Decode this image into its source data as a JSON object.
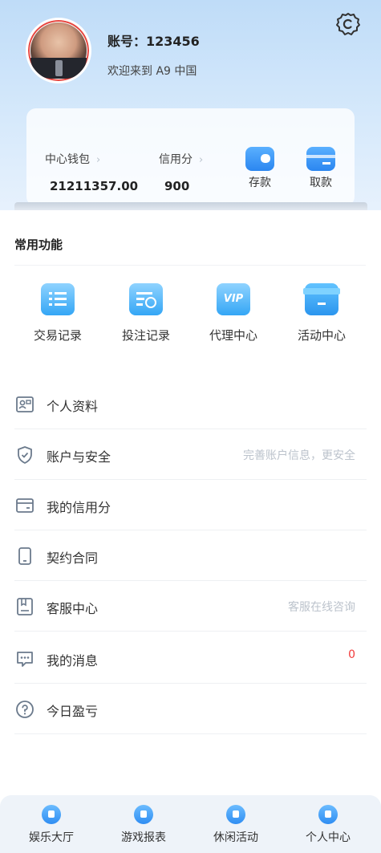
{
  "profile": {
    "account": "账号：123456",
    "welcome": "欢迎来到 A9 中国"
  },
  "wallet": {
    "center_label": "中心钱包",
    "center_value": "21211357.00",
    "credit_label": "信用分",
    "credit_value": "900",
    "deposit_label": "存款",
    "withdraw_label": "取款"
  },
  "functions": {
    "title": "常用功能",
    "items": [
      {
        "label": "交易记录",
        "icon": "list-icon"
      },
      {
        "label": "投注记录",
        "icon": "bet-record-icon"
      },
      {
        "label": "代理中心",
        "icon": "vip-icon"
      },
      {
        "label": "活动中心",
        "icon": "gift-icon"
      }
    ]
  },
  "menu": [
    {
      "label": "个人资料",
      "right": "",
      "icon": "profile-card-icon"
    },
    {
      "label": "账户与安全",
      "right": "完善账户信息，更安全",
      "icon": "shield-icon"
    },
    {
      "label": "我的信用分",
      "right": "",
      "icon": "card-icon"
    },
    {
      "label": "契约合同",
      "right": "",
      "icon": "phone-icon"
    },
    {
      "label": "客服中心",
      "right": "客服在线咨询",
      "icon": "service-icon"
    },
    {
      "label": "我的消息",
      "right": "0",
      "icon": "message-icon"
    },
    {
      "label": "今日盈亏",
      "right": "",
      "icon": "question-icon"
    }
  ],
  "tabs": [
    {
      "label": "娱乐大厅",
      "icon": "home-icon"
    },
    {
      "label": "游戏报表",
      "icon": "report-icon"
    },
    {
      "label": "休闲活动",
      "icon": "activity-icon"
    },
    {
      "label": "个人中心",
      "icon": "user-icon"
    }
  ],
  "colors": {
    "accent": "#2f8df2",
    "badge": "#f23a3a",
    "header_bg": "#c9e2fa"
  }
}
